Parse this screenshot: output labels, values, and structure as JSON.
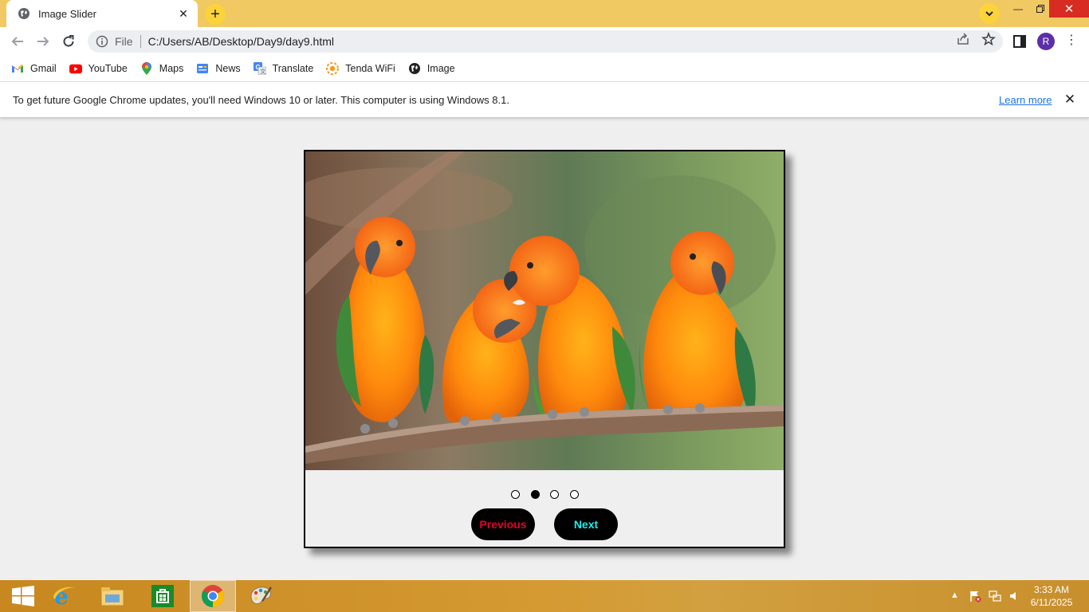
{
  "browser": {
    "tab": {
      "title": "Image Slider",
      "favicon": "globe-icon"
    },
    "address": {
      "scheme": "File",
      "url": "C:/Users/AB/Desktop/Day9/day9.html"
    },
    "profile_initial": "R",
    "bookmarks": [
      {
        "label": "Gmail",
        "icon": "gmail-icon"
      },
      {
        "label": "YouTube",
        "icon": "youtube-icon"
      },
      {
        "label": "Maps",
        "icon": "maps-icon"
      },
      {
        "label": "News",
        "icon": "news-icon"
      },
      {
        "label": "Translate",
        "icon": "translate-icon"
      },
      {
        "label": "Tenda WiFi",
        "icon": "tenda-icon"
      },
      {
        "label": "Image",
        "icon": "globe-icon"
      }
    ],
    "infobar": {
      "message": "To get future Google Chrome updates, you'll need Windows 10 or later. This computer is using Windows 8.1.",
      "link": "Learn more"
    },
    "colors": {
      "tabstrip": "#f1c963",
      "accent_button": "#fcd33b",
      "close": "#d82b21",
      "link": "#1a73e8",
      "avatar": "#5c2ea7"
    }
  },
  "page": {
    "slider": {
      "image_subject": "four orange sun conure parrots perched on a branch",
      "dot_count": 4,
      "active_dot": 2,
      "prev_label": "Previous",
      "next_label": "Next",
      "prev_color": "#e8002a",
      "next_color": "#17f0f0",
      "button_bg": "#000000"
    }
  },
  "taskbar": {
    "apps": [
      "start-icon",
      "internet-explorer-icon",
      "file-explorer-icon",
      "store-icon",
      "chrome-icon",
      "paint-icon"
    ],
    "active_app": "chrome-icon",
    "time": "3:33 AM",
    "date": "6/11/2025"
  }
}
